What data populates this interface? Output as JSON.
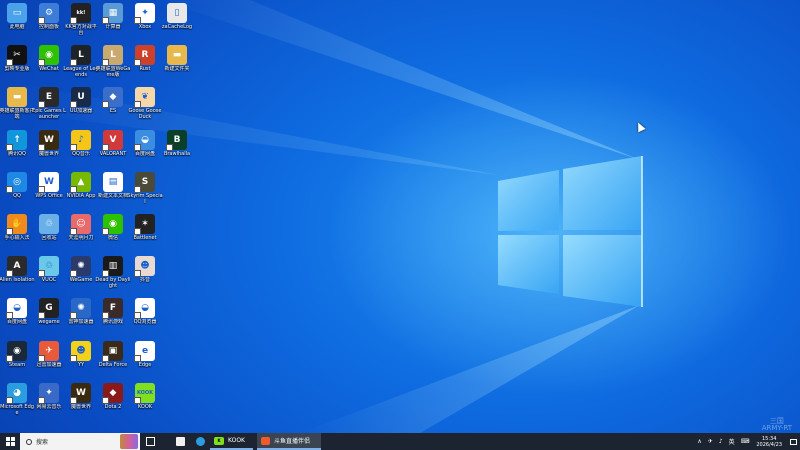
{
  "desktop": {
    "icons": [
      {
        "label": "此电脑",
        "color": "#4aa3ea",
        "glyph": "▭",
        "arrow": false
      },
      {
        "label": "控制面板",
        "color": "#3b7dd8",
        "glyph": "⚙",
        "arrow": true
      },
      {
        "label": "KK官方对战平台",
        "color": "#222222",
        "glyph": "kk!",
        "arrow": true
      },
      {
        "label": "计算器",
        "color": "#5b9bd5",
        "glyph": "▦",
        "arrow": true
      },
      {
        "label": "Xbox",
        "color": "#ffffff",
        "glyph": "✦",
        "arrow": true
      },
      {
        "label": "zaCacheLog",
        "color": "#e8e8e8",
        "glyph": "▯",
        "arrow": false
      },
      {
        "label": "剪映专业版",
        "color": "#111111",
        "glyph": "✂",
        "arrow": true
      },
      {
        "label": "WeChat",
        "color": "#2dc100",
        "glyph": "◉",
        "arrow": true
      },
      {
        "label": "League of Legends",
        "color": "#1e2328",
        "glyph": "L",
        "arrow": true
      },
      {
        "label": "英雄联盟WeGame版",
        "color": "#c8aa6e",
        "glyph": "L",
        "arrow": true
      },
      {
        "label": "Rust",
        "color": "#cd412b",
        "glyph": "R",
        "arrow": true
      },
      {
        "label": "新建文件夹",
        "color": "#e8b84a",
        "glyph": "▬",
        "arrow": false
      },
      {
        "label": "英雄联盟新客户端",
        "color": "#e8b84a",
        "glyph": "▬",
        "arrow": false
      },
      {
        "label": "Epic Games Launcher",
        "color": "#2a2a2a",
        "glyph": "E",
        "arrow": true
      },
      {
        "label": "UU加速器",
        "color": "#1a2b4a",
        "glyph": "U",
        "arrow": true
      },
      {
        "label": "ES",
        "color": "#3a6ec8",
        "glyph": "◆",
        "arrow": true
      },
      {
        "label": "Goose Goose Duck",
        "color": "#f5d7a8",
        "glyph": "❦",
        "arrow": true
      },
      {
        "label": "",
        "color": "",
        "glyph": "",
        "arrow": false
      },
      {
        "label": "腾讯QQ",
        "color": "#1296db",
        "glyph": "↑",
        "arrow": true
      },
      {
        "label": "魔兽世界",
        "color": "#3a2a10",
        "glyph": "W",
        "arrow": true
      },
      {
        "label": "QQ音乐",
        "color": "#f5c518",
        "glyph": "♪",
        "arrow": true
      },
      {
        "label": "VALORANT",
        "color": "#d13a3a",
        "glyph": "V",
        "arrow": true
      },
      {
        "label": "百度网盘",
        "color": "#3a8de0",
        "glyph": "◒",
        "arrow": true
      },
      {
        "label": "Brawlhalla",
        "color": "#0b3f2a",
        "glyph": "B",
        "arrow": true
      },
      {
        "label": "QQ",
        "color": "#1e88e5",
        "glyph": "◎",
        "arrow": true
      },
      {
        "label": "WPS Office",
        "color": "#ffffff",
        "glyph": "W",
        "arrow": true
      },
      {
        "label": "NVIDIA App",
        "color": "#76b900",
        "glyph": "▲",
        "arrow": true
      },
      {
        "label": "新建文本文档",
        "color": "#ffffff",
        "glyph": "▤",
        "arrow": false
      },
      {
        "label": "Skyrim Special",
        "color": "#4a4a3a",
        "glyph": "S",
        "arrow": true
      },
      {
        "label": "",
        "color": "",
        "glyph": "",
        "arrow": false
      },
      {
        "label": "手心输入法",
        "color": "#f08a1a",
        "glyph": "✋",
        "arrow": true
      },
      {
        "label": "回收站",
        "color": "#6ab0e8",
        "glyph": "♲",
        "arrow": false
      },
      {
        "label": "天涯明月刀",
        "color": "#e86a6a",
        "glyph": "☺",
        "arrow": true
      },
      {
        "label": "微信",
        "color": "#2dc100",
        "glyph": "◉",
        "arrow": true
      },
      {
        "label": "Battlenet",
        "color": "#222222",
        "glyph": "✶",
        "arrow": true
      },
      {
        "label": "",
        "color": "",
        "glyph": "",
        "arrow": false
      },
      {
        "label": "Alien Isolation",
        "color": "#2a2a2a",
        "glyph": "A",
        "arrow": true
      },
      {
        "label": "VUOC",
        "color": "#6ac8e8",
        "glyph": "♲",
        "arrow": true
      },
      {
        "label": "WeGame",
        "color": "#2a3a6a",
        "glyph": "✺",
        "arrow": true
      },
      {
        "label": "Dead by Daylight",
        "color": "#1a1a1a",
        "glyph": "▥",
        "arrow": true
      },
      {
        "label": "抖音",
        "color": "#e8dad0",
        "glyph": "☻",
        "arrow": true
      },
      {
        "label": "",
        "color": "",
        "glyph": "",
        "arrow": false
      },
      {
        "label": "百度网盘",
        "color": "#ffffff",
        "glyph": "◒",
        "arrow": true
      },
      {
        "label": "wegame",
        "color": "#222222",
        "glyph": "G",
        "arrow": true
      },
      {
        "label": "雷神加速器",
        "color": "#2a68c8",
        "glyph": "✺",
        "arrow": true
      },
      {
        "label": "腾讯游戏",
        "color": "#3a2a2a",
        "glyph": "F",
        "arrow": true
      },
      {
        "label": "QQ浏览器",
        "color": "#ffffff",
        "glyph": "◒",
        "arrow": true
      },
      {
        "label": "",
        "color": "",
        "glyph": "",
        "arrow": false
      },
      {
        "label": "Steam",
        "color": "#1b2838",
        "glyph": "◉",
        "arrow": true
      },
      {
        "label": "迅雷加速器",
        "color": "#e85a3a",
        "glyph": "✈",
        "arrow": true
      },
      {
        "label": "YY",
        "color": "#f5d21a",
        "glyph": "☻",
        "arrow": true
      },
      {
        "label": "Delta Force",
        "color": "#3a2a1a",
        "glyph": "▣",
        "arrow": true
      },
      {
        "label": "Edge",
        "color": "#ffffff",
        "glyph": "e",
        "arrow": true
      },
      {
        "label": "",
        "color": "",
        "glyph": "",
        "arrow": false
      },
      {
        "label": "Microsoft Edge",
        "color": "#2a9de0",
        "glyph": "◕",
        "arrow": true
      },
      {
        "label": "网易云音乐",
        "color": "#3a6ac8",
        "glyph": "✦",
        "arrow": true
      },
      {
        "label": "魔兽世界",
        "color": "#3a2a10",
        "glyph": "W",
        "arrow": true
      },
      {
        "label": "Dota 2",
        "color": "#8a1a1a",
        "glyph": "◆",
        "arrow": true
      },
      {
        "label": "KOOK",
        "color": "#80e020",
        "glyph": "KOOK",
        "arrow": true
      },
      {
        "label": "",
        "color": "",
        "glyph": "",
        "arrow": false
      }
    ]
  },
  "taskbar": {
    "search_placeholder": "搜索",
    "apps": [
      {
        "name": "KOOK"
      },
      {
        "name": "斗鱼直播伴侣"
      }
    ],
    "tray": {
      "chevron": "∧",
      "lang": "英",
      "time": "15:34",
      "date": "2026/4/23"
    }
  },
  "watermark": "三国\nARMY-RT"
}
